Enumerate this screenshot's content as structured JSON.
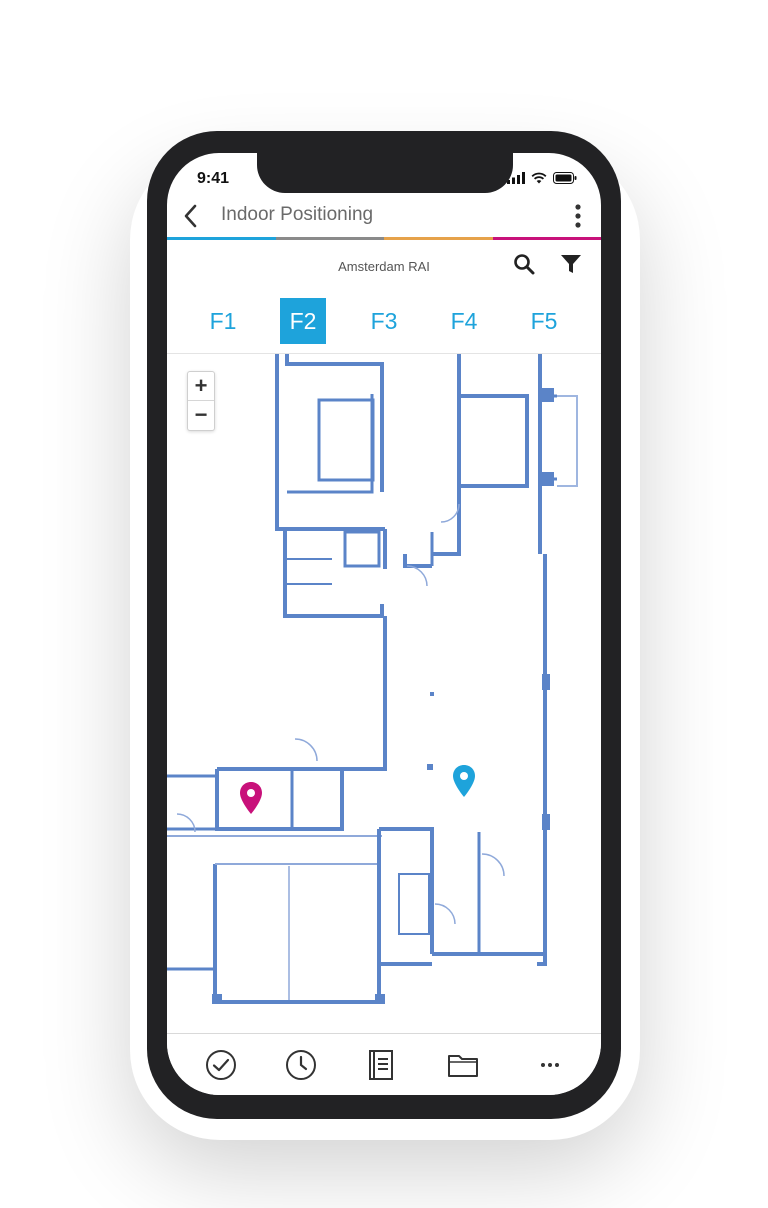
{
  "status_bar": {
    "time": "9:41"
  },
  "header": {
    "title": "Indoor Positioning"
  },
  "venue": {
    "name": "Amsterdam RAI"
  },
  "floors": [
    {
      "label": "F1",
      "active": false
    },
    {
      "label": "F2",
      "active": true
    },
    {
      "label": "F3",
      "active": false
    },
    {
      "label": "F4",
      "active": false
    },
    {
      "label": "F5",
      "active": false
    }
  ],
  "zoom": {
    "in_label": "+",
    "out_label": "−"
  },
  "colors": {
    "accent_blue": "#1ea3db",
    "accent_grey": "#8a8a8a",
    "accent_orange": "#e6a24a",
    "accent_magenta": "#c8117a",
    "wall_blue": "#5b84c8",
    "pin_magenta": "#c8117a",
    "pin_blue": "#1ea3db"
  },
  "map_pins": [
    {
      "name": "destination-pin",
      "color": "magenta"
    },
    {
      "name": "current-location-pin",
      "color": "blue"
    }
  ],
  "bottom_nav": [
    {
      "icon": "check-circle-icon"
    },
    {
      "icon": "clock-icon"
    },
    {
      "icon": "book-icon"
    },
    {
      "icon": "folder-icon"
    },
    {
      "icon": "more-horizontal-icon"
    }
  ]
}
